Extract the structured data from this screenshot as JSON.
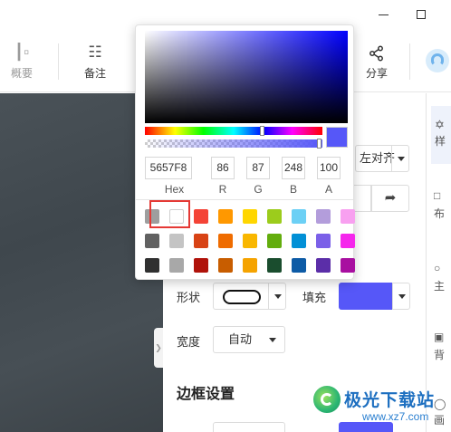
{
  "window": {
    "minimize_icon": "minimize-icon",
    "maximize_icon": "maximize-icon"
  },
  "toolbar": {
    "summary_label": "概要",
    "notes_label": "备注",
    "share_label": "分享"
  },
  "panel": {
    "align_value": "左对齐",
    "shape_label": "形状",
    "fill_label": "填充",
    "fill_color": "#5657F8",
    "width_label": "宽度",
    "width_value": "自动",
    "border_section_title": "边框设置"
  },
  "sidebar": {
    "items": [
      {
        "label": "样"
      },
      {
        "label": "布"
      },
      {
        "label": "主"
      },
      {
        "label": "背"
      },
      {
        "label": "画"
      }
    ]
  },
  "color_picker": {
    "hex_value": "5657F8",
    "r_value": "86",
    "g_value": "87",
    "b_value": "248",
    "a_value": "100",
    "hex_label": "Hex",
    "r_label": "R",
    "g_label": "G",
    "b_label": "B",
    "a_label": "A",
    "current_color": "#5657F8",
    "swatches": [
      [
        "#9e9e9e",
        "#ffffff",
        "#f44336",
        "#ff9800",
        "#ffd600",
        "#9ccc1c",
        "#6cd0f5",
        "#b39ddb",
        "#f8a0f0"
      ],
      [
        "#616161",
        "#c4c4c4",
        "#d84315",
        "#ef6c00",
        "#f9b700",
        "#63ad0d",
        "#0290d6",
        "#7b60e8",
        "#f526ec"
      ],
      [
        "#303030",
        "#a8a8a8",
        "#b0120a",
        "#c85d00",
        "#f5a300",
        "#1a4d2e",
        "#0d5ba6",
        "#5b2ea8",
        "#a80fa0"
      ]
    ],
    "selected_swatch": "#ffffff"
  },
  "watermark": {
    "title": "极光下载站",
    "url": "www.xz7.com"
  }
}
